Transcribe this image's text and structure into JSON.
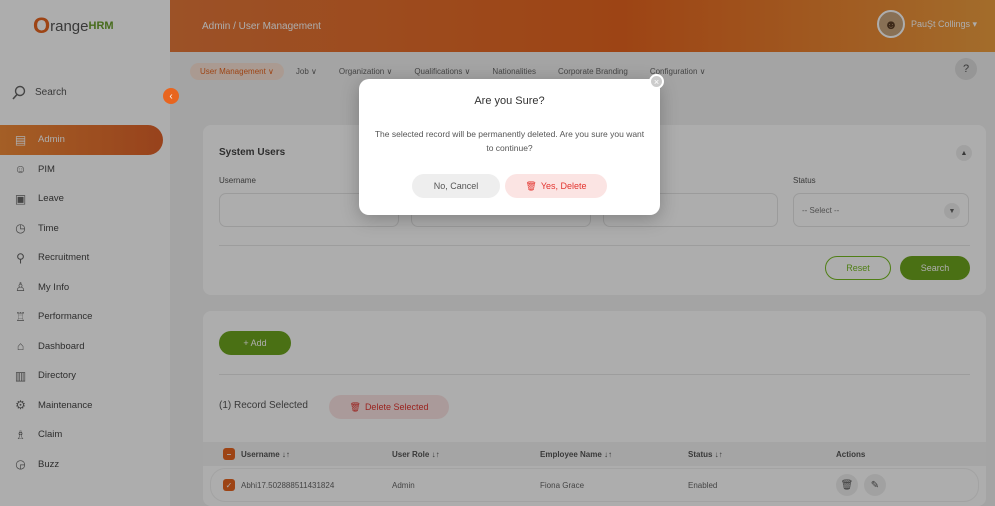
{
  "logo": {
    "o": "O",
    "text": "range",
    "hrm": "HRM"
  },
  "sidebar": {
    "search": "Search",
    "items": [
      {
        "label": "Admin",
        "icon": "admin-icon"
      },
      {
        "label": "PIM",
        "icon": "people-icon"
      },
      {
        "label": "Leave",
        "icon": "leave-icon"
      },
      {
        "label": "Time",
        "icon": "time-icon"
      },
      {
        "label": "Recruitment",
        "icon": "recruitment-icon"
      },
      {
        "label": "My Info",
        "icon": "my-info-icon"
      },
      {
        "label": "Performance",
        "icon": "performance-icon"
      },
      {
        "label": "Dashboard",
        "icon": "dashboard-icon"
      },
      {
        "label": "Directory",
        "icon": "directory-icon"
      },
      {
        "label": "Maintenance",
        "icon": "maintenance-icon"
      },
      {
        "label": "Claim",
        "icon": "claim-icon"
      },
      {
        "label": "Buzz",
        "icon": "buzz-icon"
      }
    ]
  },
  "topbar": {
    "breadcrumb": "Admin / User Management",
    "user": "PauŞt Collings ▾"
  },
  "subnav": [
    "User Management ∨",
    "Job ∨",
    "Organization ∨",
    "Qualifications ∨",
    "Nationalities",
    "Corporate Branding",
    "Configuration ∨"
  ],
  "filter": {
    "title": "System Users",
    "username_label": "Username",
    "status_label": "Status",
    "status_value": "-- Select --",
    "reset": "Reset",
    "search": "Search"
  },
  "records": {
    "add": "+ Add",
    "selected": "(1) Record Selected",
    "delete_selected": "Delete Selected",
    "headers": [
      "Username ↓↑",
      "User Role ↓↑",
      "Employee Name ↓↑",
      "Status ↓↑",
      "Actions"
    ],
    "row": {
      "username": "Abhi17.502888511431824",
      "role": "Admin",
      "employee": "Fiona Grace",
      "status": "Enabled"
    }
  },
  "modal": {
    "title": "Are you Sure?",
    "message": "The selected record will be permanently deleted. Are you sure you want to continue?",
    "cancel": "No, Cancel",
    "confirm": "Yes, Delete"
  },
  "colors": {
    "accent": "#e8651f",
    "green": "#6ea51e",
    "danger": "#e3342f"
  }
}
